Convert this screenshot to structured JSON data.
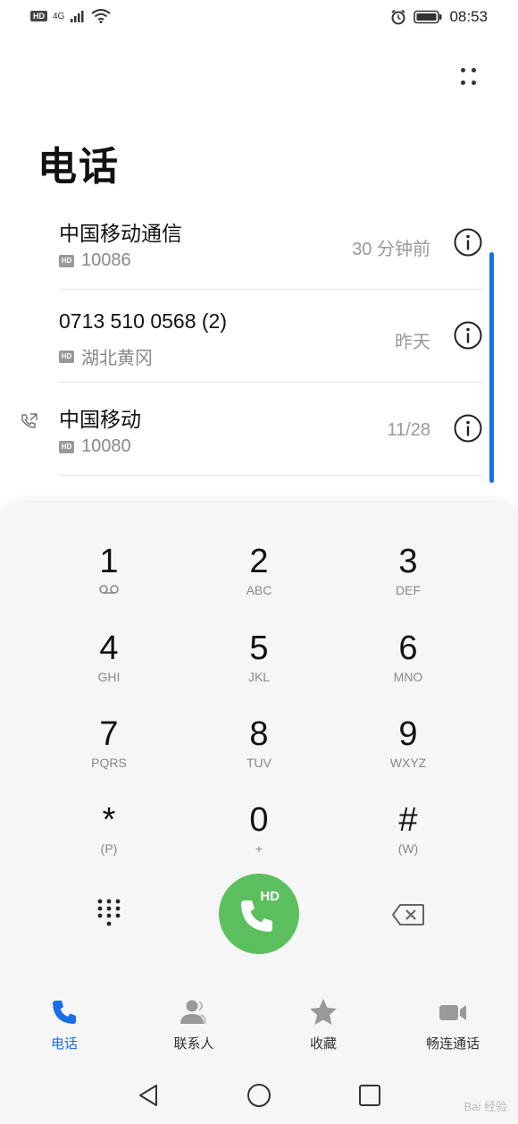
{
  "status_bar": {
    "hd_label": "HD",
    "network": "4G",
    "time": "08:53"
  },
  "page_title": "电话",
  "calls": [
    {
      "name": "中国移动通信",
      "number": "10086",
      "time": "30 分钟前",
      "has_type_icon": false
    },
    {
      "name": "0713 510 0568 (2)",
      "number": "湖北黄冈",
      "time": "昨天",
      "has_type_icon": false
    },
    {
      "name": "中国移动",
      "number": "10080",
      "time": "11/28",
      "has_type_icon": true
    }
  ],
  "hd_tag": "HD",
  "dialpad": {
    "keys": [
      {
        "digit": "1",
        "letters": ""
      },
      {
        "digit": "2",
        "letters": "ABC"
      },
      {
        "digit": "3",
        "letters": "DEF"
      },
      {
        "digit": "4",
        "letters": "GHI"
      },
      {
        "digit": "5",
        "letters": "JKL"
      },
      {
        "digit": "6",
        "letters": "MNO"
      },
      {
        "digit": "7",
        "letters": "PQRS"
      },
      {
        "digit": "8",
        "letters": "TUV"
      },
      {
        "digit": "9",
        "letters": "WXYZ"
      },
      {
        "digit": "*",
        "letters": "(P)"
      },
      {
        "digit": "0",
        "letters": "+"
      },
      {
        "digit": "#",
        "letters": "(W)"
      }
    ],
    "call_hd_label": "HD"
  },
  "bottom_nav": [
    {
      "label": "电话",
      "icon": "phone-icon",
      "active": true
    },
    {
      "label": "联系人",
      "icon": "contacts-icon",
      "active": false
    },
    {
      "label": "收藏",
      "icon": "star-icon",
      "active": false
    },
    {
      "label": "畅连通话",
      "icon": "video-call-icon",
      "active": false
    }
  ],
  "colors": {
    "accent": "#1a6ee8",
    "call_green": "#5cbf5e"
  },
  "watermark": "Bai 经验"
}
